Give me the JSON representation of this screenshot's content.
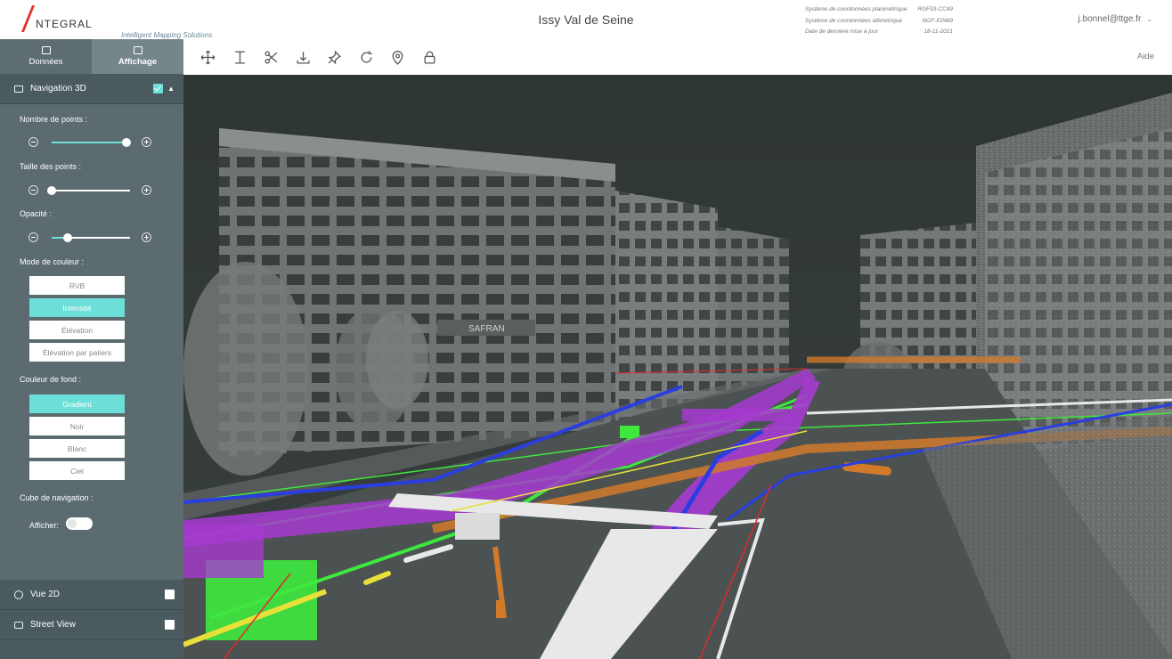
{
  "header": {
    "logo_text": "NTEGRAL",
    "logo_tagline": "Intelligent Mapping Solutions",
    "title": "Issy Val de Seine",
    "meta": [
      {
        "label": "Système de coordonnées planimétrique",
        "value": "RGF93-CC49"
      },
      {
        "label": "Système de coordonnées altimétrique",
        "value": "NGF-IGN69"
      },
      {
        "label": "Date de dernière mise à jour",
        "value": "18-11-2021"
      }
    ],
    "user": "j.bonnel@ttge.fr"
  },
  "sidebar": {
    "tabs": [
      {
        "label": "Données",
        "icon": "document-icon",
        "active": false
      },
      {
        "label": "Affichage",
        "icon": "monitor-icon",
        "active": true
      }
    ],
    "nav3d": {
      "title": "Navigation 3D",
      "checked": true,
      "points_label": "Nombre de points :",
      "points_value": 0.95,
      "size_label": "Taille des points :",
      "size_value": 0.0,
      "opacity_label": "Opacité :",
      "opacity_value": 0.2,
      "color_mode_label": "Mode de couleur :",
      "color_modes": [
        "RVB",
        "Intensité",
        "Élévation",
        "Élévation par paliers"
      ],
      "color_mode_selected": "Intensité",
      "bg_label": "Couleur de fond :",
      "bg_options": [
        "Gradient",
        "Noir",
        "Blanc",
        "Ciel"
      ],
      "bg_selected": "Gradient",
      "cube_label": "Cube de navigation :",
      "show_label": "Afficher:",
      "show_on": false
    },
    "vue2d": {
      "label": "Vue 2D",
      "checked": false
    },
    "streetview": {
      "label": "Street View",
      "checked": false
    }
  },
  "toolbar": {
    "tools": [
      "move-icon",
      "height-measure-icon",
      "scissors-icon",
      "download-icon",
      "pin-icon",
      "rotate-icon",
      "location-icon",
      "lock-icon"
    ],
    "help": "Aide"
  },
  "viewer": {
    "building_sign": "SAFRAN",
    "colors": {
      "green": "#3ee83e",
      "purple": "#a63ad0",
      "orange": "#d07a2a",
      "blue": "#2a3ee0",
      "white": "#e8e8e8",
      "yellow": "#e8e03a",
      "red": "#e02a2a"
    }
  }
}
